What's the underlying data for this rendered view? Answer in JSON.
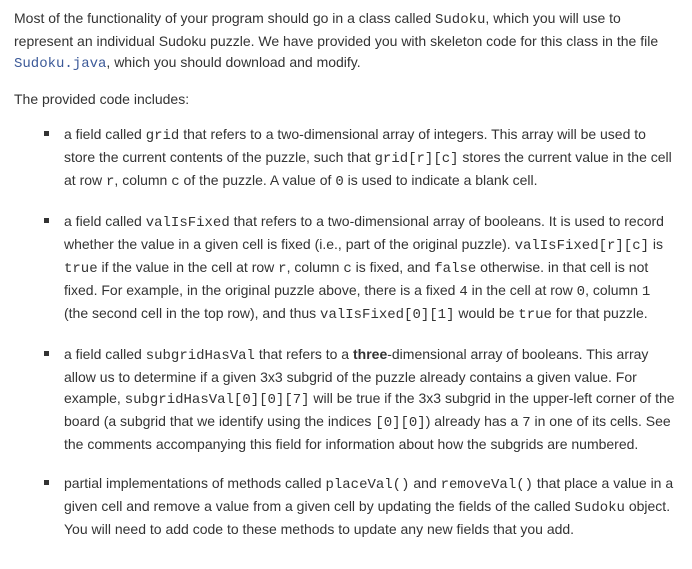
{
  "intro": {
    "p1_a": "Most of the functionality of your program should go in a class called ",
    "p1_code1": "Sudoku",
    "p1_b": ", which you will use to represent an individual Sudoku puzzle. We have provided you with skeleton code for this class in the file ",
    "p1_link": "Sudoku.java",
    "p1_c": ", which you should download and modify."
  },
  "lead": "The provided code includes:",
  "items": [
    {
      "segs": [
        {
          "t": "text",
          "v": "a field called "
        },
        {
          "t": "code",
          "v": "grid"
        },
        {
          "t": "text",
          "v": " that refers to a two-dimensional array of integers. This array will be used to store the current contents of the puzzle, such that "
        },
        {
          "t": "code",
          "v": "grid[r][c]"
        },
        {
          "t": "text",
          "v": " stores the current value in the cell at row "
        },
        {
          "t": "code",
          "v": "r"
        },
        {
          "t": "text",
          "v": ", column "
        },
        {
          "t": "code",
          "v": "c"
        },
        {
          "t": "text",
          "v": " of the puzzle. A value of "
        },
        {
          "t": "code",
          "v": "0"
        },
        {
          "t": "text",
          "v": " is used to indicate a blank cell."
        }
      ]
    },
    {
      "segs": [
        {
          "t": "text",
          "v": "a field called "
        },
        {
          "t": "code",
          "v": "valIsFixed"
        },
        {
          "t": "text",
          "v": " that refers to a two-dimensional array of booleans. It is used to record whether the value in a given cell is fixed (i.e., part of the original puzzle). "
        },
        {
          "t": "code",
          "v": "valIsFixed[r][c]"
        },
        {
          "t": "text",
          "v": " is "
        },
        {
          "t": "code",
          "v": "true"
        },
        {
          "t": "text",
          "v": " if the value in the cell at row "
        },
        {
          "t": "code",
          "v": "r"
        },
        {
          "t": "text",
          "v": ", column "
        },
        {
          "t": "code",
          "v": "c"
        },
        {
          "t": "text",
          "v": " is fixed, and "
        },
        {
          "t": "code",
          "v": "false"
        },
        {
          "t": "text",
          "v": " otherwise. in that cell is not fixed. For example, in the original puzzle above, there is a fixed "
        },
        {
          "t": "code",
          "v": "4"
        },
        {
          "t": "text",
          "v": " in the cell at row "
        },
        {
          "t": "code",
          "v": "0"
        },
        {
          "t": "text",
          "v": ", column "
        },
        {
          "t": "code",
          "v": "1"
        },
        {
          "t": "text",
          "v": " (the second cell in the top row), and thus "
        },
        {
          "t": "code",
          "v": "valIsFixed[0][1]"
        },
        {
          "t": "text",
          "v": " would be "
        },
        {
          "t": "code",
          "v": "true"
        },
        {
          "t": "text",
          "v": " for that puzzle."
        }
      ]
    },
    {
      "segs": [
        {
          "t": "text",
          "v": "a field called "
        },
        {
          "t": "code",
          "v": "subgridHasVal"
        },
        {
          "t": "text",
          "v": " that refers to a "
        },
        {
          "t": "bold",
          "v": "three"
        },
        {
          "t": "text",
          "v": "-dimensional array of booleans. This array allow us to determine if a given 3x3 subgrid of the puzzle already contains a given value. For example, "
        },
        {
          "t": "code",
          "v": "subgridHasVal[0][0][7]"
        },
        {
          "t": "text",
          "v": " will be true if the 3x3 subgrid in the upper-left corner of the board (a subgrid that we identify using the indices "
        },
        {
          "t": "code",
          "v": "[0][0]"
        },
        {
          "t": "text",
          "v": ") already has a "
        },
        {
          "t": "code",
          "v": "7"
        },
        {
          "t": "text",
          "v": " in one of its cells. See the comments accompanying this field for information about how the subgrids are numbered."
        }
      ]
    },
    {
      "segs": [
        {
          "t": "text",
          "v": "partial implementations of methods called "
        },
        {
          "t": "code",
          "v": "placeVal()"
        },
        {
          "t": "text",
          "v": " and "
        },
        {
          "t": "code",
          "v": "removeVal()"
        },
        {
          "t": "text",
          "v": " that place a value in a given cell and remove a value from a given cell by updating the fields of the called "
        },
        {
          "t": "code",
          "v": "Sudoku"
        },
        {
          "t": "text",
          "v": " object. You will need to add code to these methods to update any new fields that you add."
        }
      ]
    }
  ]
}
